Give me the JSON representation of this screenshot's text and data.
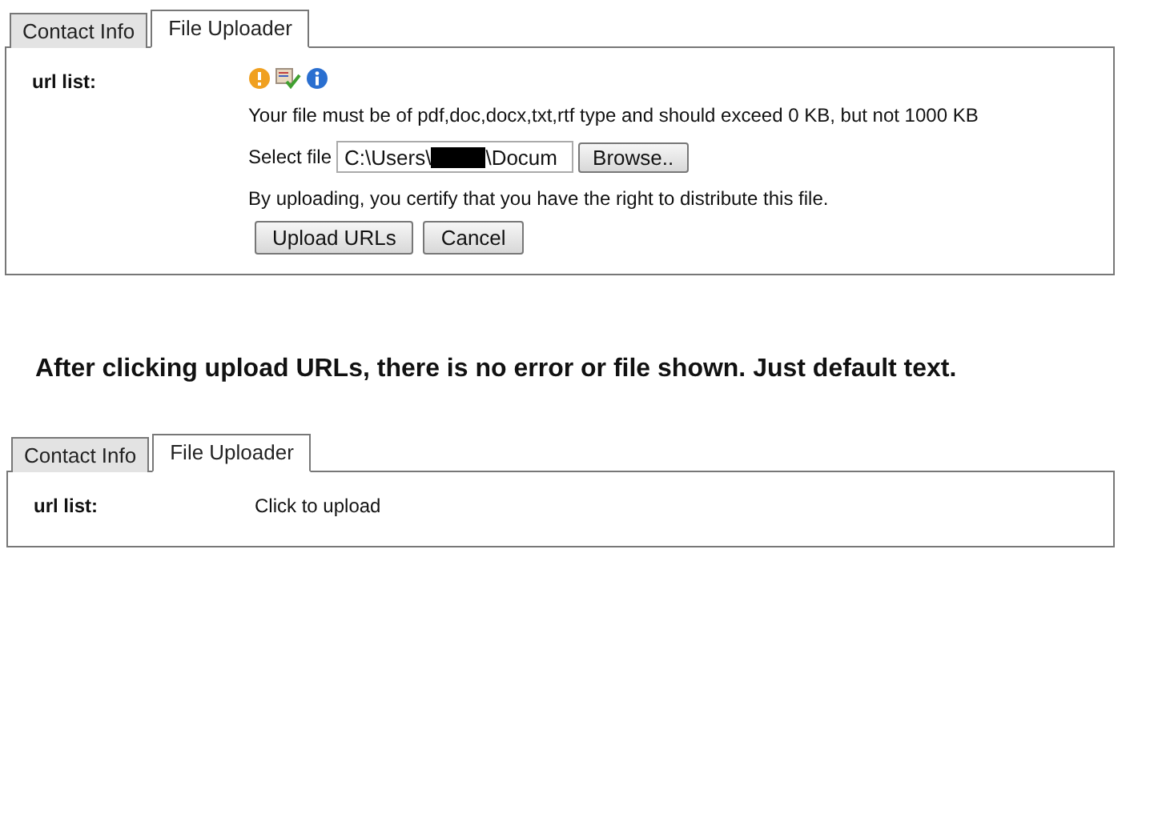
{
  "sections": [
    {
      "kind": "panel",
      "tabs": [
        {
          "label": "Contact Info",
          "selected": false
        },
        {
          "label": "File Uploader",
          "selected": true
        }
      ],
      "field_label": "url list:",
      "content": {
        "kind": "uploader",
        "requirements": "Your file must be of pdf,doc,docx,txt,rtf type and should exceed 0 KB, but not 1000 KB",
        "select_label": "Select file",
        "file_value_before": "C:\\Users\\",
        "file_value_after": "\\Docum",
        "browse": "Browse..",
        "certify": "By uploading, you certify that you have the right to distribute this file.",
        "buttons": [
          "Upload URLs",
          "Cancel"
        ]
      }
    },
    {
      "kind": "note",
      "text": "After clicking upload URLs, there is no error or  file shown.  Just default text."
    },
    {
      "kind": "panel",
      "tabs": [
        {
          "label": "Contact Info",
          "selected": false
        },
        {
          "label": "File Uploader",
          "selected": true
        }
      ],
      "field_label": "url list:",
      "content": {
        "kind": "placeholder",
        "text": "Click to upload"
      }
    }
  ]
}
